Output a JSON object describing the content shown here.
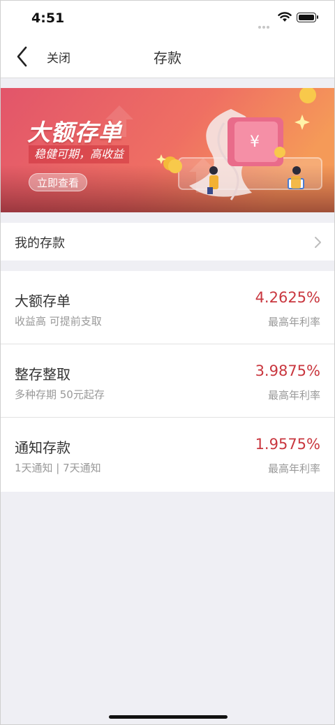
{
  "status_bar": {
    "time": "4:51"
  },
  "navbar": {
    "close_label": "关闭",
    "title": "存款"
  },
  "banner": {
    "title": "大额存单",
    "subtitle": "稳健可期，高收益",
    "button_label": "立即查看"
  },
  "my_deposit": {
    "label": "我的存款"
  },
  "products": [
    {
      "name": "大额存单",
      "desc": "收益高 可提前支取",
      "rate": "4.2625%",
      "rate_label": "最高年利率"
    },
    {
      "name": "整存整取",
      "desc": "多种存期 50元起存",
      "rate": "3.9875%",
      "rate_label": "最高年利率"
    },
    {
      "name": "通知存款",
      "desc": "1天通知 | 7天通知",
      "rate": "1.9575%",
      "rate_label": "最高年利率"
    }
  ],
  "colors": {
    "accent_rate": "#c9373f",
    "banner_start": "#e2556a",
    "banner_end": "#f59a58"
  }
}
